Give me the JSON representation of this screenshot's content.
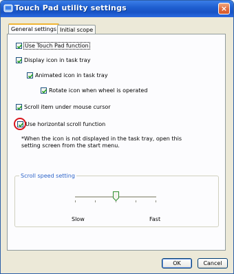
{
  "window": {
    "title": "Touch Pad utility settings",
    "close_glyph": "×"
  },
  "tabs": [
    {
      "label": "General settings",
      "active": true
    },
    {
      "label": "Initial scope",
      "active": false
    }
  ],
  "options": [
    {
      "label": "Use Touch Pad function",
      "checked": true
    },
    {
      "label": "Display icon in task tray",
      "checked": true
    },
    {
      "label": "Animated icon in task tray",
      "checked": true
    },
    {
      "label": "Rotate icon when wheel is operated",
      "checked": true
    },
    {
      "label": "Scroll item under mouse cursor",
      "checked": true
    },
    {
      "label": "Use horizontal scroll function",
      "checked": true
    }
  ],
  "note": "*When the icon is not displayed in the task tray, open this setting screen from the start menu.",
  "scroll_speed": {
    "title": "Scroll speed setting",
    "slow_label": "Slow",
    "fast_label": "Fast",
    "level_fraction": 0.5
  },
  "buttons": {
    "ok": "OK",
    "cancel": "Cancel"
  },
  "colors": {
    "title_bar": "#1f5fd0",
    "group_title": "#2b63c9",
    "highlight_ring": "#d8141c"
  }
}
